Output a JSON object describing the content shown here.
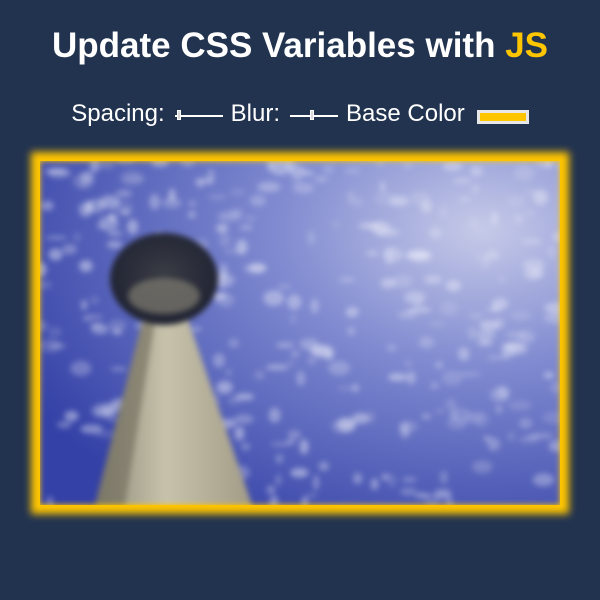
{
  "header": {
    "title_main": "Update CSS Variables with ",
    "title_highlight": "JS"
  },
  "controls": {
    "spacing_label": "Spacing:",
    "spacing_value": 0.1,
    "blur_label": "Blur:",
    "blur_value": 0.45,
    "base_color_label": "Base Color"
  },
  "colors": {
    "background": "#223350",
    "base": "#ffc600",
    "text": "#ffffff"
  },
  "image": {
    "subject": "tower against a blue sky",
    "icon": "photo-image"
  }
}
